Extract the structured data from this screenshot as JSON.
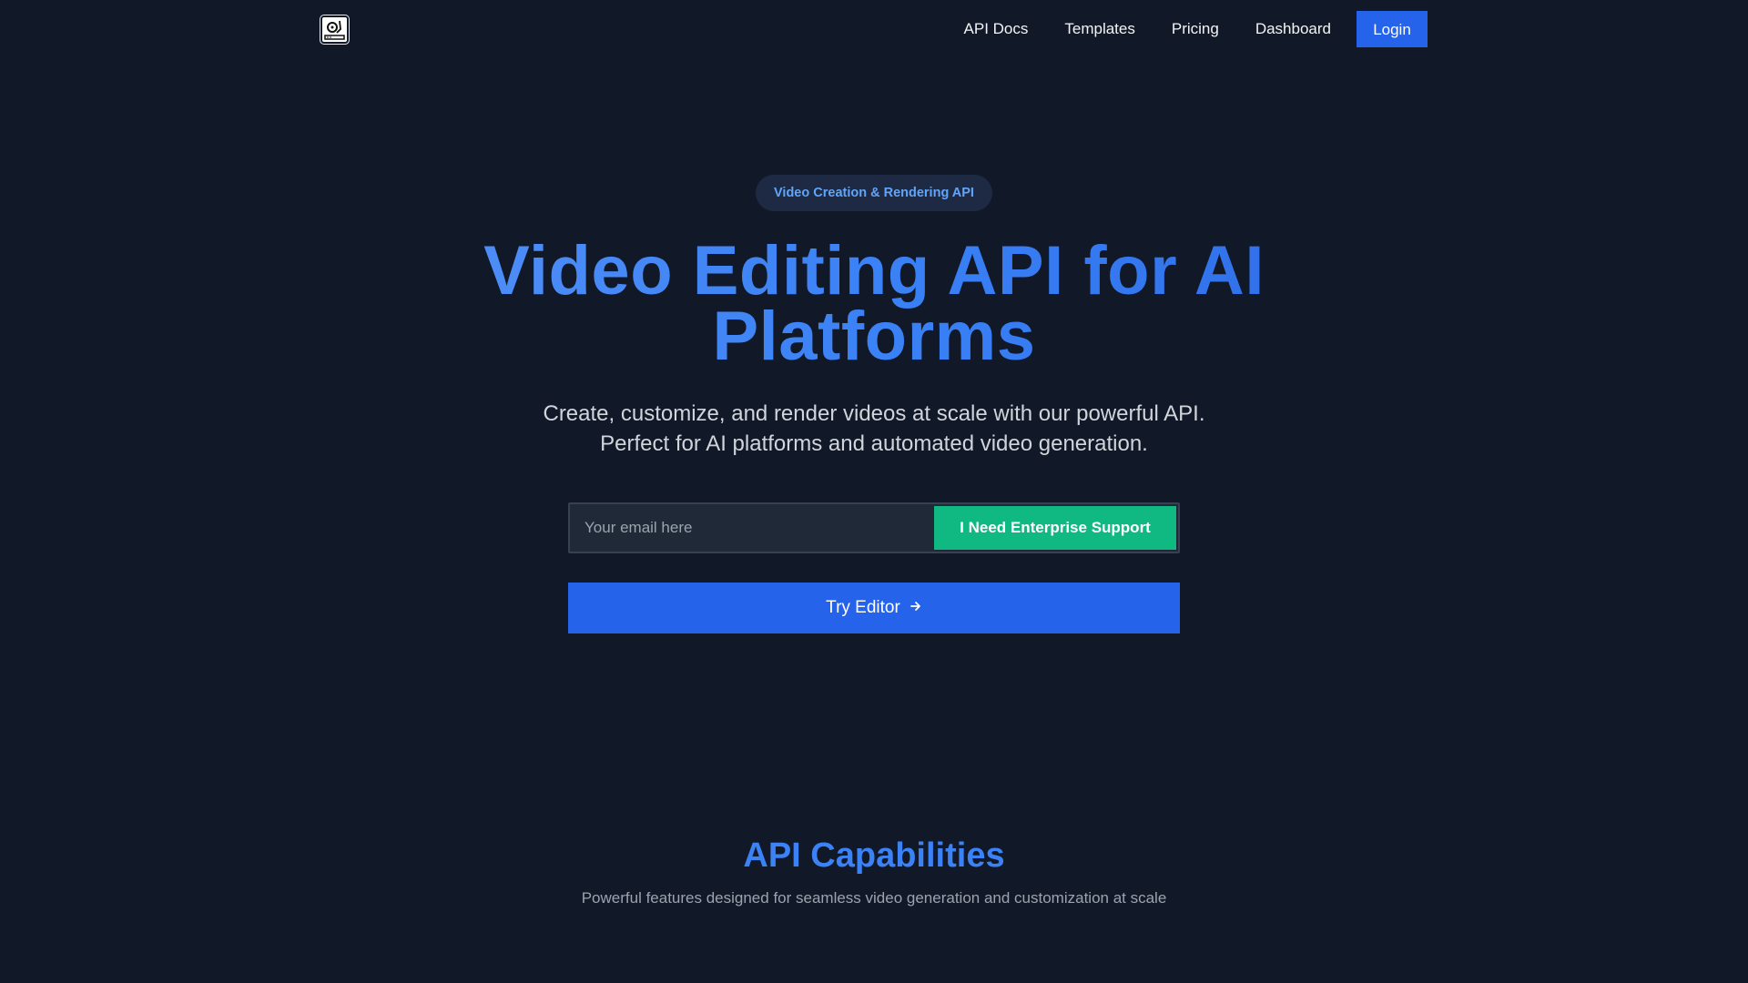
{
  "nav": {
    "logo_icon": "turntable-logo-icon",
    "links": [
      {
        "label": "API Docs"
      },
      {
        "label": "Templates"
      },
      {
        "label": "Pricing"
      },
      {
        "label": "Dashboard"
      }
    ],
    "login_label": "Login"
  },
  "hero": {
    "badge": "Video Creation & Rendering API",
    "title_line1": "Video Editing API for AI",
    "title_line2": "Platforms",
    "subtitle": "Create, customize, and render videos at scale with our powerful API. Perfect for AI platforms and automated video generation."
  },
  "form": {
    "email_placeholder": "Your email here",
    "email_value": "",
    "enterprise_label": "I Need Enterprise Support"
  },
  "cta": {
    "try_label": "Try Editor",
    "arrow_icon": "arrow-right-icon"
  },
  "capabilities": {
    "title": "API Capabilities",
    "subtitle": "Powerful features designed for seamless video generation and customization at scale"
  },
  "colors": {
    "background": "#111827",
    "primary": "#2563eb",
    "accent_green": "#10b981",
    "title_blue": "#3b82f6"
  }
}
